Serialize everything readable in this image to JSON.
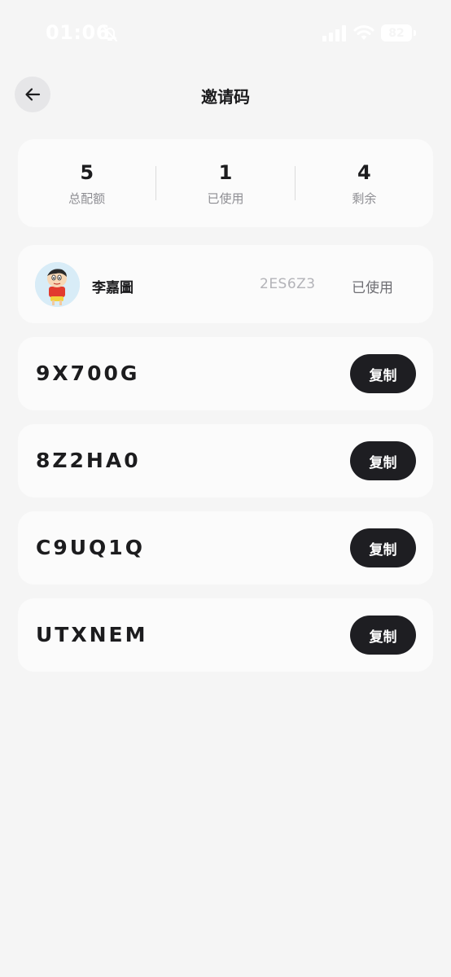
{
  "status_bar": {
    "time": "01:06",
    "battery": "82",
    "icons": [
      "bell-off-icon",
      "signal-icon",
      "wifi-icon",
      "battery-icon"
    ]
  },
  "header": {
    "title": "邀请码",
    "back_icon": "arrow-left-icon"
  },
  "stats": {
    "total": {
      "value": "5",
      "label": "总配额"
    },
    "used": {
      "value": "1",
      "label": "已使用"
    },
    "remaining": {
      "value": "4",
      "label": "剩余"
    }
  },
  "used_codes": [
    {
      "user_name": "李嘉圖",
      "code": "2ES6Z3",
      "status": "已使用",
      "avatar": "cartoon-avatar"
    }
  ],
  "available_codes": [
    {
      "code": "9X700G",
      "copy_label": "复制"
    },
    {
      "code": "8Z2HA0",
      "copy_label": "复制"
    },
    {
      "code": "C9UQ1Q",
      "copy_label": "复制"
    },
    {
      "code": "UTXNEM",
      "copy_label": "复制"
    }
  ],
  "colors": {
    "background": "#f5f5f5",
    "card": "#fbfbfb",
    "button": "#1e1e22",
    "muted_text": "#8e8e93"
  }
}
